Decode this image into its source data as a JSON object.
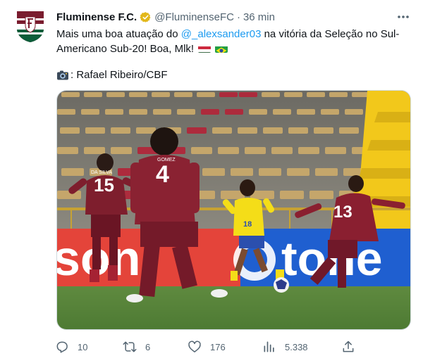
{
  "tweet": {
    "author_name": "Fluminense F.C.",
    "author_handle": "@FluminenseFC",
    "separator": "·",
    "time": "36 min",
    "text_before": "Mais uma boa atuação do ",
    "mention": "@_alexsander03",
    "text_after": " na vitória da Seleção no Sul-Americano Sub-20! Boa, Mlk!",
    "credit": ": Rafael Ribeiro/CBF",
    "flags": [
      "hungary-flag",
      "brazil-flag"
    ]
  },
  "photo": {
    "jersey_numbers": [
      "15",
      "4",
      "18",
      "13"
    ],
    "jersey_names": [
      "DA SILVA",
      "GOMEZ"
    ],
    "board_text": [
      "son",
      "tone"
    ]
  },
  "actions": {
    "replies": "10",
    "retweets": "6",
    "likes": "176",
    "views": "5.338"
  },
  "icons": [
    "more-icon",
    "verified-icon",
    "camera-icon",
    "reply-icon",
    "retweet-icon",
    "like-icon",
    "views-icon",
    "share-icon"
  ],
  "colors": {
    "accent": "#1d9bf0",
    "muted": "#536471",
    "verified": "#e2b719",
    "fluminense_maroon": "#7a1c2e",
    "fluminense_green": "#0b5e3a"
  }
}
